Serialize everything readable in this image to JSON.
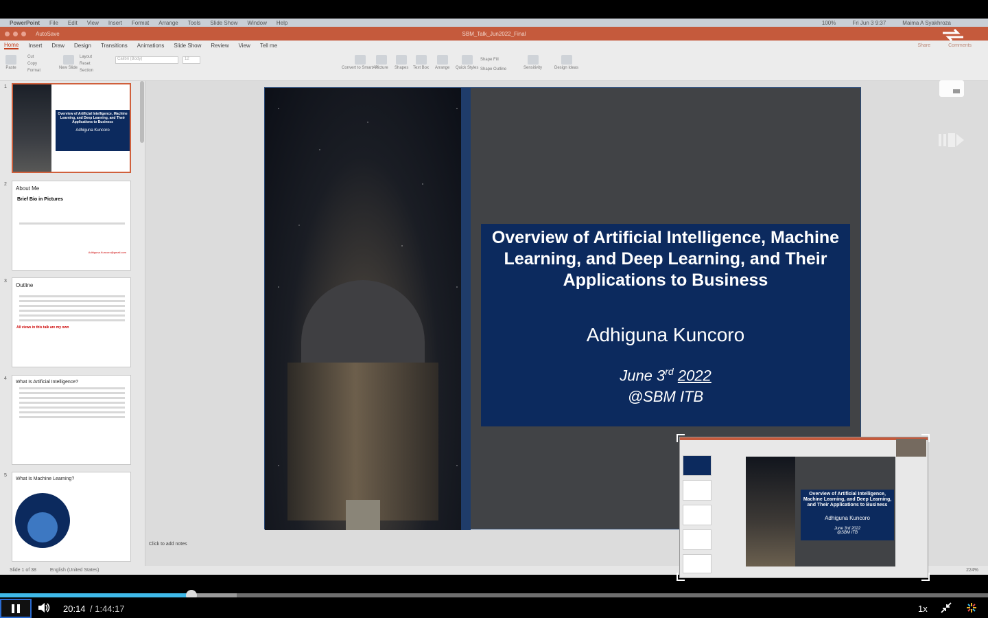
{
  "mac_menu": [
    "PowerPoint",
    "File",
    "Edit",
    "View",
    "Insert",
    "Format",
    "Arrange",
    "Tools",
    "Slide Show",
    "Window",
    "Help"
  ],
  "mac_status": {
    "battery": "100%",
    "datetime": "Fri Jun 3  9:37",
    "user": "Maima A Syakhroza"
  },
  "window_title": "SBM_Talk_Jun2022_Final",
  "autosave": "AutoSave",
  "ribbon_tabs": [
    "Home",
    "Insert",
    "Draw",
    "Design",
    "Transitions",
    "Animations",
    "Slide Show",
    "Review",
    "View",
    "Tell me"
  ],
  "ribbon_right": {
    "share": "Share",
    "comments": "Comments"
  },
  "ribbon": {
    "paste": "Paste",
    "cut": "Cut",
    "copy": "Copy",
    "format": "Format",
    "new_slide": "New Slide",
    "layout": "Layout",
    "reset": "Reset",
    "section": "Section",
    "font": "Calibri (Body)",
    "size": "12",
    "picture": "Picture",
    "shapes": "Shapes",
    "text_box": "Text Box",
    "arrange": "Arrange",
    "quick_styles": "Quick Styles",
    "shape_fill": "Shape Fill",
    "shape_outline": "Shape Outline",
    "sensitivity": "Sensitivity",
    "design_ideas": "Design Ideas",
    "convert": "Convert to SmartArt"
  },
  "thumbnails": [
    {
      "num": "1",
      "title": "Overview of Artificial Intelligence, Machine Learning, and Deep Learning, and Their Applications to Business",
      "sub": "Adhiguna Kuncoro"
    },
    {
      "num": "2",
      "title": "About Me",
      "sub": "Brief Bio in Pictures",
      "email": "Adhiguna.Kuncoro@gmail.com"
    },
    {
      "num": "3",
      "title": "Outline",
      "sub": "All views in this talk are my own"
    },
    {
      "num": "4",
      "title": "What Is Artificial Intelligence?"
    },
    {
      "num": "5",
      "title": "What Is Machine Learning?"
    }
  ],
  "slide": {
    "title": "Overview of Artificial Intelligence, Machine Learning, and Deep Learning, and Their Applications to Business",
    "author": "Adhiguna Kuncoro",
    "date_prefix": "June 3",
    "date_sup": "rd",
    "date_year": "2022",
    "venue": "@SBM ITB"
  },
  "notes_placeholder": "Click to add notes",
  "status": {
    "slide": "Slide 1 of 38",
    "language": "English (United States)",
    "zoom": "224%"
  },
  "pip": {
    "title": "Overview of Artificial Intelligence, Machine Learning, and Deep Learning, and Their Applications to Business",
    "author": "Adhiguna Kuncoro",
    "date": "June 3rd 2022",
    "venue": "@SBM ITB"
  },
  "player": {
    "current": "20:14",
    "total": "/ 1:44:17",
    "speed": "1x",
    "progress": 0.194
  }
}
